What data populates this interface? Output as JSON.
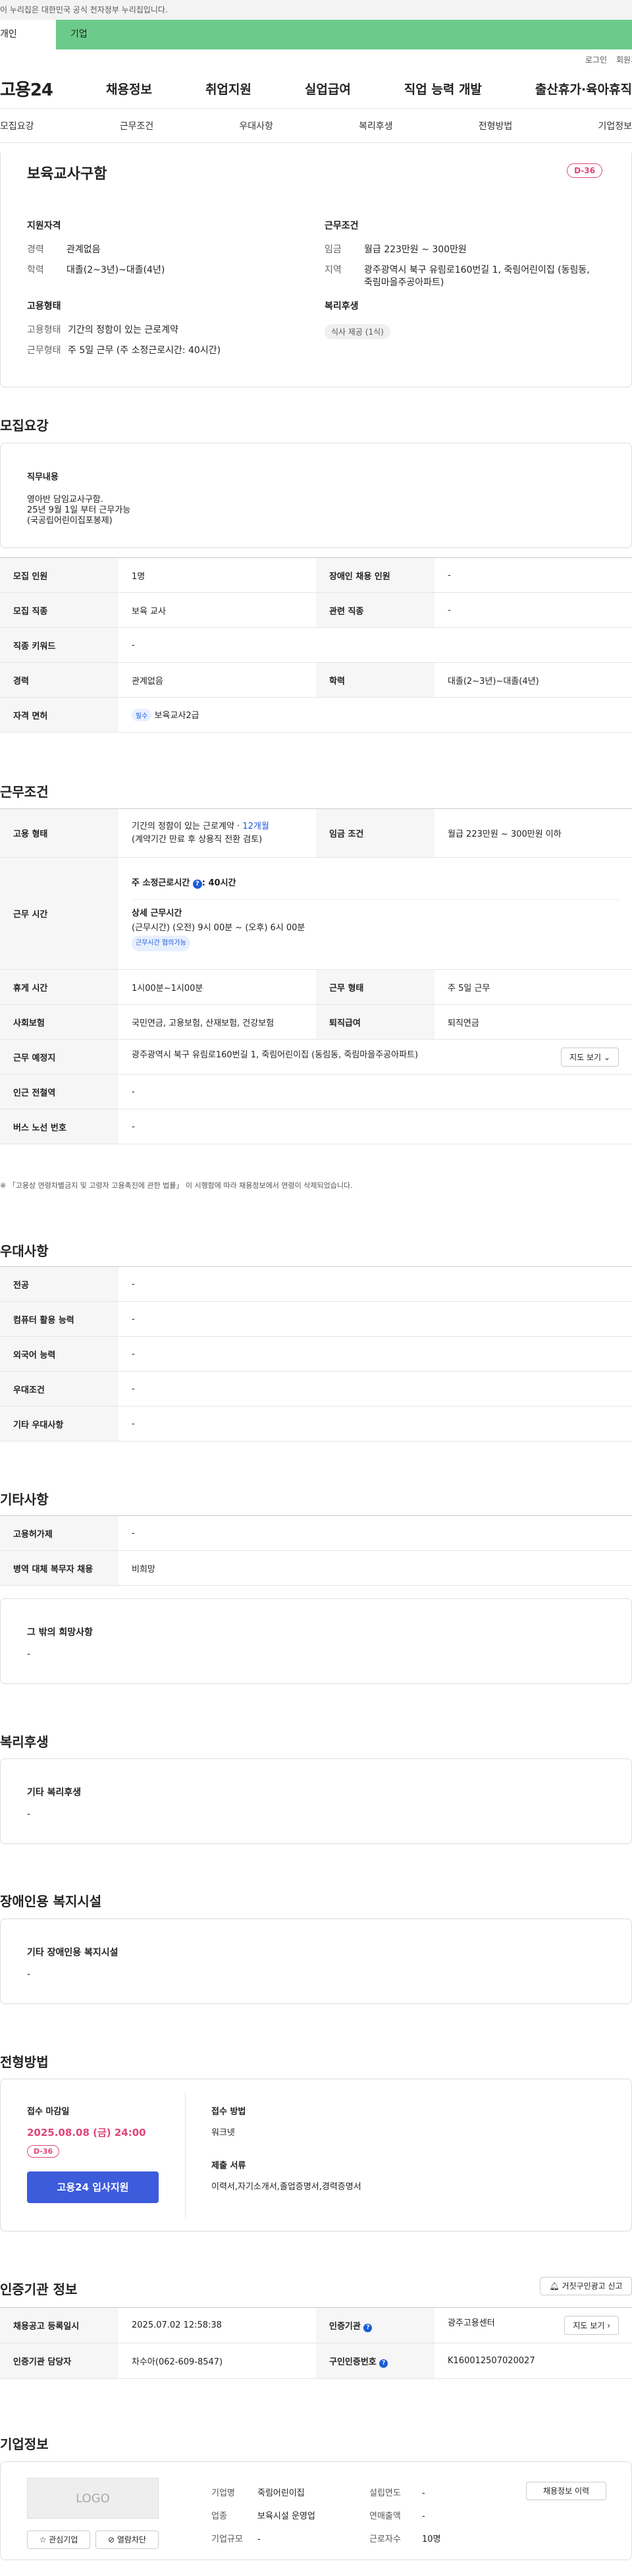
{
  "gov_banner": "이 누리집은 대한민국 공식 전자정부 누리집입니다.",
  "top_tabs": [
    "개인",
    "기업"
  ],
  "utility": [
    "로그인",
    "회원가입"
  ],
  "gnb": {
    "logo": "고용24",
    "items": [
      "채용정보",
      "취업지원",
      "실업급여",
      "직업 능력 개발",
      "출산휴가·육아휴직"
    ]
  },
  "subnav": [
    "모집요강",
    "근무조건",
    "우대사항",
    "복리후생",
    "전형방법",
    "기업정보"
  ],
  "summary": {
    "title": "보육교사구함",
    "dday": "D-36",
    "qual": {
      "heading": "지원자격",
      "rows": [
        {
          "k": "경력",
          "v": "관계없음"
        },
        {
          "k": "학력",
          "v": "대졸(2~3년)~대졸(4년)"
        }
      ]
    },
    "work": {
      "heading": "근무조건",
      "rows": [
        {
          "k": "임금",
          "v": "월급 223만원 ~ 300만원"
        },
        {
          "k": "지역",
          "v": "광주광역시 북구 유림로160번길 1, 죽림어린이집 (동림동, 죽림마을주공아파트)"
        }
      ]
    },
    "emp": {
      "heading": "고용형태",
      "rows": [
        {
          "k": "고용형태",
          "v": "기간의 정함이 있는 근로계약"
        },
        {
          "k": "근무형태",
          "v": "주 5일 근무 (주 소정근로시간: 40시간)"
        }
      ]
    },
    "welfare": {
      "heading": "복리후생",
      "chip": "식사 제공 (1식)"
    }
  },
  "recruit": {
    "heading": "모집요강",
    "duty_label": "직무내용",
    "duty_lines": [
      "영아반 담임교사구함.",
      "25년 9월 1일 부터 근무가능",
      "(국공립어린이집포봉제)"
    ],
    "rows": {
      "r1": {
        "a": "모집 인원",
        "b": "1명",
        "c": "장애인 채용 인원",
        "d": "-"
      },
      "r2": {
        "a": "모집 직종",
        "b": "보육 교사",
        "c": "관련 직종",
        "d": "-"
      },
      "r3": {
        "a": "직종 키워드",
        "b": "-"
      },
      "r4": {
        "a": "경력",
        "b": "관계없음",
        "c": "학력",
        "d": "대졸(2~3년)~대졸(4년)"
      },
      "r5": {
        "a": "자격 면허",
        "chip": "필수",
        "b": "보육교사2급"
      }
    }
  },
  "cond": {
    "heading": "근무조건",
    "emp_label": "고용 형태",
    "emp_v1": "기간의 정함이 있는 근로계약 · ",
    "emp_v1b": "12개월",
    "emp_v2": "(계약기간 만료 후 상용직 전환 검토)",
    "wage_label": "임금 조건",
    "wage_v": "월급 223만원 ~ 300만원 이하",
    "time_label": "근무 시간",
    "time_a": "주 소정근로시간",
    "time_a2": ": 40시간",
    "time_b": "상세 근무시간",
    "time_c": "(근무시간) (오전) 9시 00분 ~ (오후) 6시 00분",
    "time_chip": "근무시간 협의가능",
    "rest_label": "휴게 시간",
    "rest_v": "1시00분~1시00분",
    "form_label": "근무 형태",
    "form_v": "주 5일 근무",
    "ins_label": "사회보험",
    "ins_v": "국민연금, 고용보험, 산재보험, 건강보험",
    "sev_label": "퇴직급여",
    "sev_v": "퇴직연금",
    "loc_label": "근무 예정지",
    "loc_v": "광주광역시 북구 유림로160번길 1, 죽림어린이집 (동림동, 죽림마을주공아파트)",
    "map_btn": "지도 보기",
    "sub_label": "인근 전철역",
    "sub_v": "-",
    "bus_label": "버스 노선 번호",
    "bus_v": "-",
    "note": "※ 「고용상 연령차별금지 및 고령자 고용촉진에 관한 법률」 이 시행함에 따라 채용정보에서 연령이 삭제되었습니다."
  },
  "pref": {
    "heading": "우대사항",
    "rows": [
      {
        "k": "전공",
        "v": "-"
      },
      {
        "k": "컴퓨터 활용 능력",
        "v": "-"
      },
      {
        "k": "외국어 능력",
        "v": "-"
      },
      {
        "k": "우대조건",
        "v": "-"
      },
      {
        "k": "기타 우대사항",
        "v": "-"
      }
    ]
  },
  "etc": {
    "heading": "기타사항",
    "rows": [
      {
        "k": "고용허가제",
        "v": "-"
      },
      {
        "k": "병역 대체 복무자 채용",
        "v": "비희망"
      }
    ],
    "box_t": "그 밖의 희망사항",
    "box_v": "-"
  },
  "welfare": {
    "heading": "복리후생",
    "box_t": "기타 복리후생",
    "box_v": "-"
  },
  "disab": {
    "heading": "장애인용 복지시설",
    "box_t": "기타 장애인용 복지시설",
    "box_v": "-"
  },
  "sel": {
    "heading": "전형방법",
    "deadline_label": "접수 마감일",
    "deadline": "2025.08.08 (금) 24:00",
    "dday": "D-36",
    "apply": "고용24 입사지원",
    "method_label": "접수 방법",
    "method": "워크넷",
    "docs_label": "제출 서류",
    "docs": "이력서,자기소개서,졸업증명서,경력증명서"
  },
  "cert": {
    "heading": "인증기관 정보",
    "report": "거짓구인광고 신고",
    "r1": {
      "a": "채용공고 등록일시",
      "b": "2025.07.02 12:58:38",
      "c": "인증기관",
      "d": "광주고용센터",
      "btn": "지도 보기"
    },
    "r2": {
      "a": "인증기관 담당자",
      "b": "차수아(062-609-8547)",
      "c": "구인인증번호",
      "d": "K160012507020027"
    }
  },
  "company": {
    "heading": "기업정보",
    "logo": "LOGO",
    "fav": "관심기업",
    "block": "열람차단",
    "history": "채용정보 이력",
    "fields": [
      {
        "k": "기업명",
        "v": "죽림어린이집"
      },
      {
        "k": "설립연도",
        "v": "-"
      },
      {
        "k": "업종",
        "v": "보육시설 운영업"
      },
      {
        "k": "연매출액",
        "v": "-"
      },
      {
        "k": "기업규모",
        "v": "-"
      },
      {
        "k": "근로자수",
        "v": "10명"
      }
    ]
  }
}
